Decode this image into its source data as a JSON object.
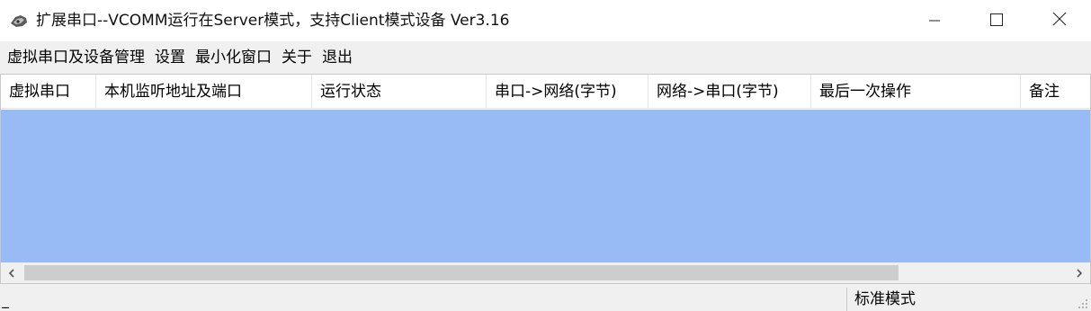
{
  "window": {
    "title": "扩展串口--VCOMM运行在Server模式，支持Client模式设备  Ver3.16",
    "icon": "app-logo-icon"
  },
  "menu": {
    "items": [
      "虚拟串口及设备管理",
      "设置",
      "最小化窗口",
      "关于",
      "退出"
    ]
  },
  "table": {
    "columns": [
      "虚拟串口",
      "本机监听地址及端口",
      "运行状态",
      "串口->网络(字节)",
      "网络->串口(字节)",
      "最后一次操作",
      "备注"
    ],
    "rows": [],
    "selection_color": "#99bbf5"
  },
  "status": {
    "left_text": "_",
    "mode": "标准模式"
  }
}
